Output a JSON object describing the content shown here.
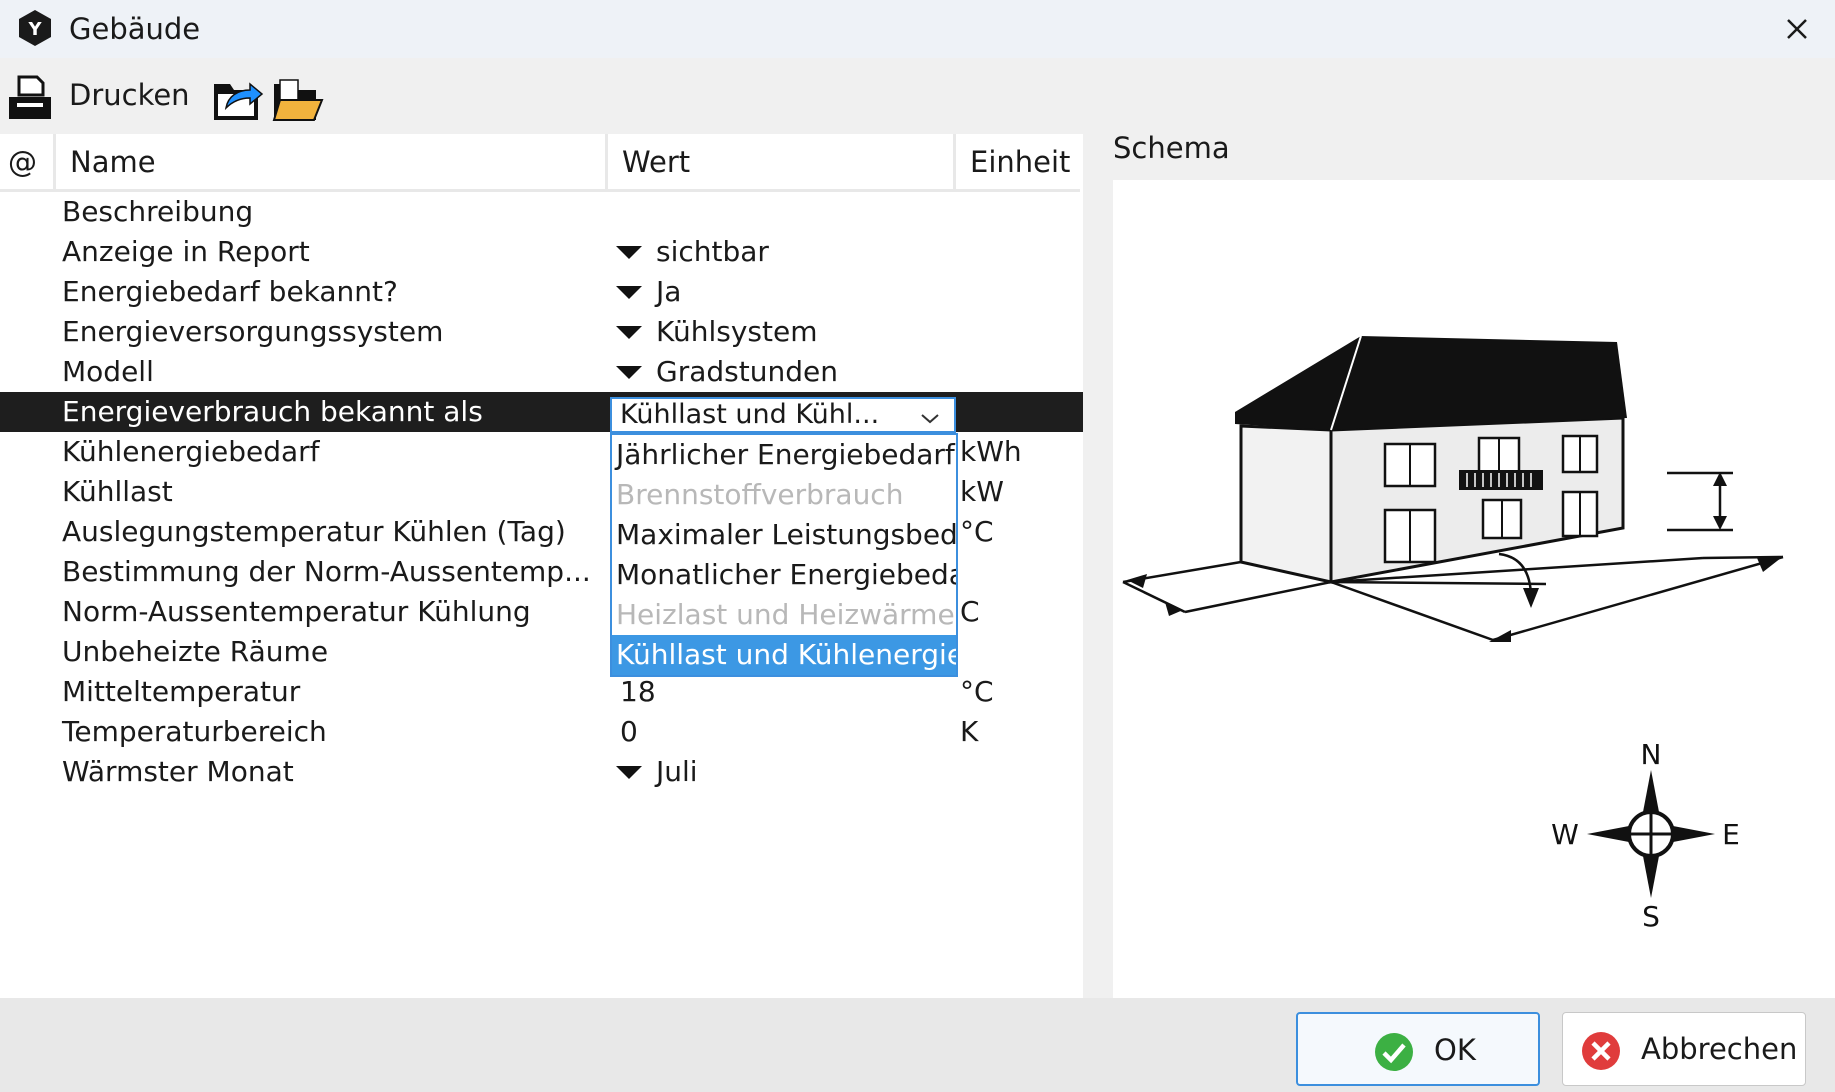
{
  "window": {
    "title": "Gebäude"
  },
  "toolbar": {
    "print_label": "Drucken"
  },
  "table": {
    "headers": {
      "at": "@",
      "name": "Name",
      "value": "Wert",
      "unit": "Einheit"
    },
    "rows": [
      {
        "name": "Beschreibung",
        "value": "",
        "unit": "",
        "dropdown": false
      },
      {
        "name": "Anzeige in Report",
        "value": "sichtbar",
        "unit": "",
        "dropdown": true
      },
      {
        "name": "Energiebedarf bekannt?",
        "value": "Ja",
        "unit": "",
        "dropdown": true
      },
      {
        "name": "Energieversorgungssystem",
        "value": "Kühlsystem",
        "unit": "",
        "dropdown": true
      },
      {
        "name": "Modell",
        "value": "Gradstunden",
        "unit": "",
        "dropdown": true
      },
      {
        "name": "Energieverbrauch bekannt als",
        "value": "Kühllast und Kühl...",
        "unit": "",
        "dropdown": false,
        "selected": true
      },
      {
        "name": "Kühlenergiebedarf",
        "value": "",
        "unit": "kWh",
        "dropdown": false
      },
      {
        "name": "Kühllast",
        "value": "",
        "unit": "kW",
        "dropdown": false
      },
      {
        "name": "Auslegungstemperatur Kühlen (Tag)",
        "value": "",
        "unit": "°C",
        "dropdown": false
      },
      {
        "name": "Bestimmung der Norm-Aussentemp...",
        "value": "",
        "unit": "",
        "dropdown": false
      },
      {
        "name": "Norm-Aussentemperatur Kühlung",
        "value": "",
        "unit": "C",
        "dropdown": false
      },
      {
        "name": "Unbeheizte Räume",
        "value": "",
        "unit": "",
        "dropdown": false
      },
      {
        "name": "Mitteltemperatur",
        "value": "18",
        "unit": "°C",
        "dropdown": false
      },
      {
        "name": "Temperaturbereich",
        "value": "0",
        "unit": "K",
        "dropdown": false
      },
      {
        "name": "Wärmster Monat",
        "value": "Juli",
        "unit": "",
        "dropdown": true
      }
    ]
  },
  "combo": {
    "value": "Kühllast und Kühl...",
    "options": [
      {
        "label": "Jährlicher Energiebedarf",
        "state": "normal"
      },
      {
        "label": "Brennstoffverbrauch",
        "state": "disabled"
      },
      {
        "label": "Maximaler Leistungsbedarf",
        "state": "normal"
      },
      {
        "label": "Monatlicher Energiebedarf",
        "state": "normal"
      },
      {
        "label": "Heizlast und Heizwärme",
        "state": "disabled"
      },
      {
        "label": "Kühllast und Kühlenergie",
        "state": "selected"
      }
    ]
  },
  "schema": {
    "label": "Schema",
    "compass": {
      "n": "N",
      "e": "E",
      "s": "S",
      "w": "W"
    }
  },
  "buttons": {
    "ok": "OK",
    "cancel": "Abbrechen"
  },
  "colors": {
    "accent": "#3c98e4",
    "selected_row": "#1e1e1e",
    "ok_green": "#3cb043",
    "cancel_red": "#e03c3c"
  }
}
